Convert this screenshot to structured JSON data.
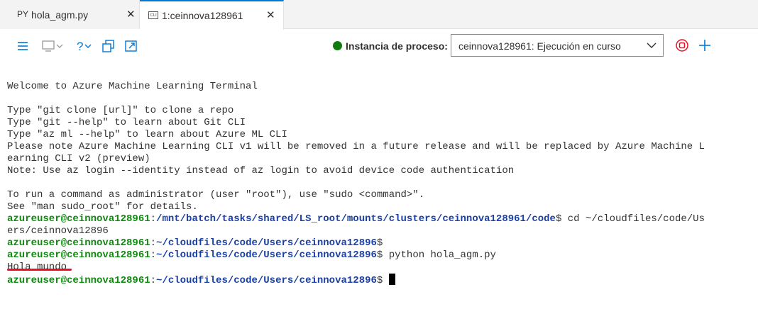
{
  "tabs": [
    {
      "prefix": "PY",
      "label": "hola_agm.py",
      "close": "✕"
    },
    {
      "prefix": "CLI",
      "label": "1:ceinnova128961",
      "close": "✕"
    }
  ],
  "toolbar": {
    "status_label": "Instancia de proceso:",
    "status_color": "#107c10",
    "compute_select_value": "ceinnova128961: Ejecución en curso",
    "accent": "#0078d4",
    "stop_color": "#e81123"
  },
  "terminal": {
    "lines": [
      {
        "text": "Welcome to Azure Machine Learning Terminal"
      },
      {
        "text": ""
      },
      {
        "text": "Type \"git clone [url]\" to clone a repo"
      },
      {
        "text": "Type \"git --help\" to learn about Git CLI"
      },
      {
        "text": "Type \"az ml --help\" to learn about Azure ML CLI"
      },
      {
        "text": "Please note Azure Machine Learning CLI v1 will be removed in a future release and will be replaced by Azure Machine L"
      },
      {
        "text": "earning CLI v2 (preview)"
      },
      {
        "text": "Note: Use az login --identity instead of az login to avoid device code authentication"
      },
      {
        "text": ""
      },
      {
        "text": "To run a command as administrator (user \"root\"), use \"sudo <command>\"."
      },
      {
        "text": "See \"man sudo_root\" for details."
      },
      {
        "user": "azureuser@ceinnova128961",
        "sep": ":",
        "path": "/mnt/batch/tasks/shared/LS_root/mounts/clusters/ceinnova128961/code",
        "cmd": "$ cd ~/cloudfiles/code/Us"
      },
      {
        "text": "ers/ceinnova12896"
      },
      {
        "user": "azureuser@ceinnova128961",
        "sep": ":",
        "path": "~/cloudfiles/code/Users/ceinnova12896",
        "cmd": "$"
      },
      {
        "user": "azureuser@ceinnova128961",
        "sep": ":",
        "path": "~/cloudfiles/code/Users/ceinnova12896",
        "cmd": "$ python hola_agm.py"
      },
      {
        "text": "Hola mundo"
      },
      {
        "user": "azureuser@ceinnova128961",
        "sep": ":",
        "path": "~/cloudfiles/code/Users/ceinnova12896",
        "cmd": "$ "
      }
    ]
  }
}
